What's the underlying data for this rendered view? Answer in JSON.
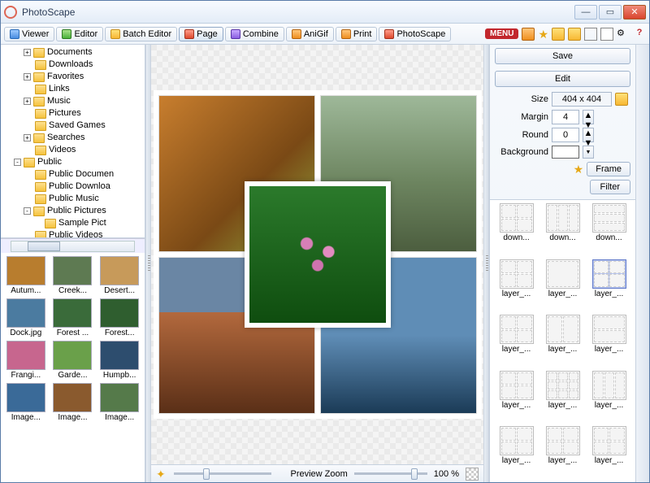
{
  "app": {
    "title": "PhotoScape"
  },
  "tabs": [
    {
      "label": "Viewer"
    },
    {
      "label": "Editor"
    },
    {
      "label": "Batch Editor"
    },
    {
      "label": "Page",
      "active": true
    },
    {
      "label": "Combine"
    },
    {
      "label": "AniGif"
    },
    {
      "label": "Print"
    },
    {
      "label": "PhotoScape"
    }
  ],
  "menuBadge": "MENU",
  "tree": [
    {
      "ind": 24,
      "exp": "+",
      "label": "Documents"
    },
    {
      "ind": 24,
      "exp": "",
      "label": "Downloads"
    },
    {
      "ind": 24,
      "exp": "+",
      "label": "Favorites"
    },
    {
      "ind": 24,
      "exp": "",
      "label": "Links"
    },
    {
      "ind": 24,
      "exp": "+",
      "label": "Music"
    },
    {
      "ind": 24,
      "exp": "",
      "label": "Pictures"
    },
    {
      "ind": 24,
      "exp": "",
      "label": "Saved Games"
    },
    {
      "ind": 24,
      "exp": "+",
      "label": "Searches"
    },
    {
      "ind": 24,
      "exp": "",
      "label": "Videos"
    },
    {
      "ind": 12,
      "exp": "-",
      "label": "Public"
    },
    {
      "ind": 24,
      "exp": "",
      "label": "Public Documen"
    },
    {
      "ind": 24,
      "exp": "",
      "label": "Public Downloa"
    },
    {
      "ind": 24,
      "exp": "",
      "label": "Public Music"
    },
    {
      "ind": 24,
      "exp": "-",
      "label": "Public Pictures"
    },
    {
      "ind": 36,
      "exp": "",
      "label": "Sample Pict"
    },
    {
      "ind": 24,
      "exp": "",
      "label": "Public Videos"
    }
  ],
  "thumbs": [
    {
      "label": "Autum..."
    },
    {
      "label": "Creek..."
    },
    {
      "label": "Desert..."
    },
    {
      "label": "Dock.jpg"
    },
    {
      "label": "Forest ..."
    },
    {
      "label": "Forest..."
    },
    {
      "label": "Frangi..."
    },
    {
      "label": "Garde..."
    },
    {
      "label": "Humpb..."
    },
    {
      "label": "Image..."
    },
    {
      "label": "Image..."
    },
    {
      "label": "Image..."
    }
  ],
  "thumbColors": [
    "#b87d2e",
    "#5e7a52",
    "#c79a5a",
    "#4b7ba0",
    "#3a6b3a",
    "#2f5e2f",
    "#c7668e",
    "#6aa04a",
    "#2d4d6e",
    "#3a6a98",
    "#8a5a2e",
    "#557a4a"
  ],
  "zoom": {
    "label": "Preview Zoom",
    "value": "100 %"
  },
  "controls": {
    "save": "Save",
    "edit": "Edit",
    "sizeLabel": "Size",
    "sizeValue": "404 x 404",
    "marginLabel": "Margin",
    "marginValue": "4",
    "roundLabel": "Round",
    "roundValue": "0",
    "bgLabel": "Background",
    "frame": "Frame",
    "filter": "Filter"
  },
  "layouts": [
    {
      "label": "down...",
      "g": "1fr 1fr/1fr 1fr"
    },
    {
      "label": "down...",
      "g": "1fr/1fr 1fr 1fr"
    },
    {
      "label": "down...",
      "g": "1fr 1fr 1fr/1fr"
    },
    {
      "label": "layer_...",
      "g": "1fr 1fr/1fr 1fr"
    },
    {
      "label": "layer_...",
      "g": "1fr/1fr"
    },
    {
      "label": "layer_...",
      "g": "1fr 1fr/1fr 1fr",
      "sel": true
    },
    {
      "label": "layer_...",
      "g": "1fr 1fr/1fr 1fr"
    },
    {
      "label": "layer_...",
      "g": "1fr/1fr 1fr"
    },
    {
      "label": "layer_...",
      "g": "1fr 1fr/1fr"
    },
    {
      "label": "layer_...",
      "g": "1fr 1fr/1fr 1fr"
    },
    {
      "label": "layer_...",
      "g": "1fr 1fr 1fr/1fr 1fr 1fr"
    },
    {
      "label": "layer_...",
      "g": "1fr/1fr 1fr 1fr"
    },
    {
      "label": "layer_...",
      "g": "1fr 1fr/1fr 1fr"
    },
    {
      "label": "layer_...",
      "g": "1fr 1fr/1fr 1fr"
    },
    {
      "label": "layer_...",
      "g": "1fr 1fr/1fr 1fr"
    }
  ]
}
